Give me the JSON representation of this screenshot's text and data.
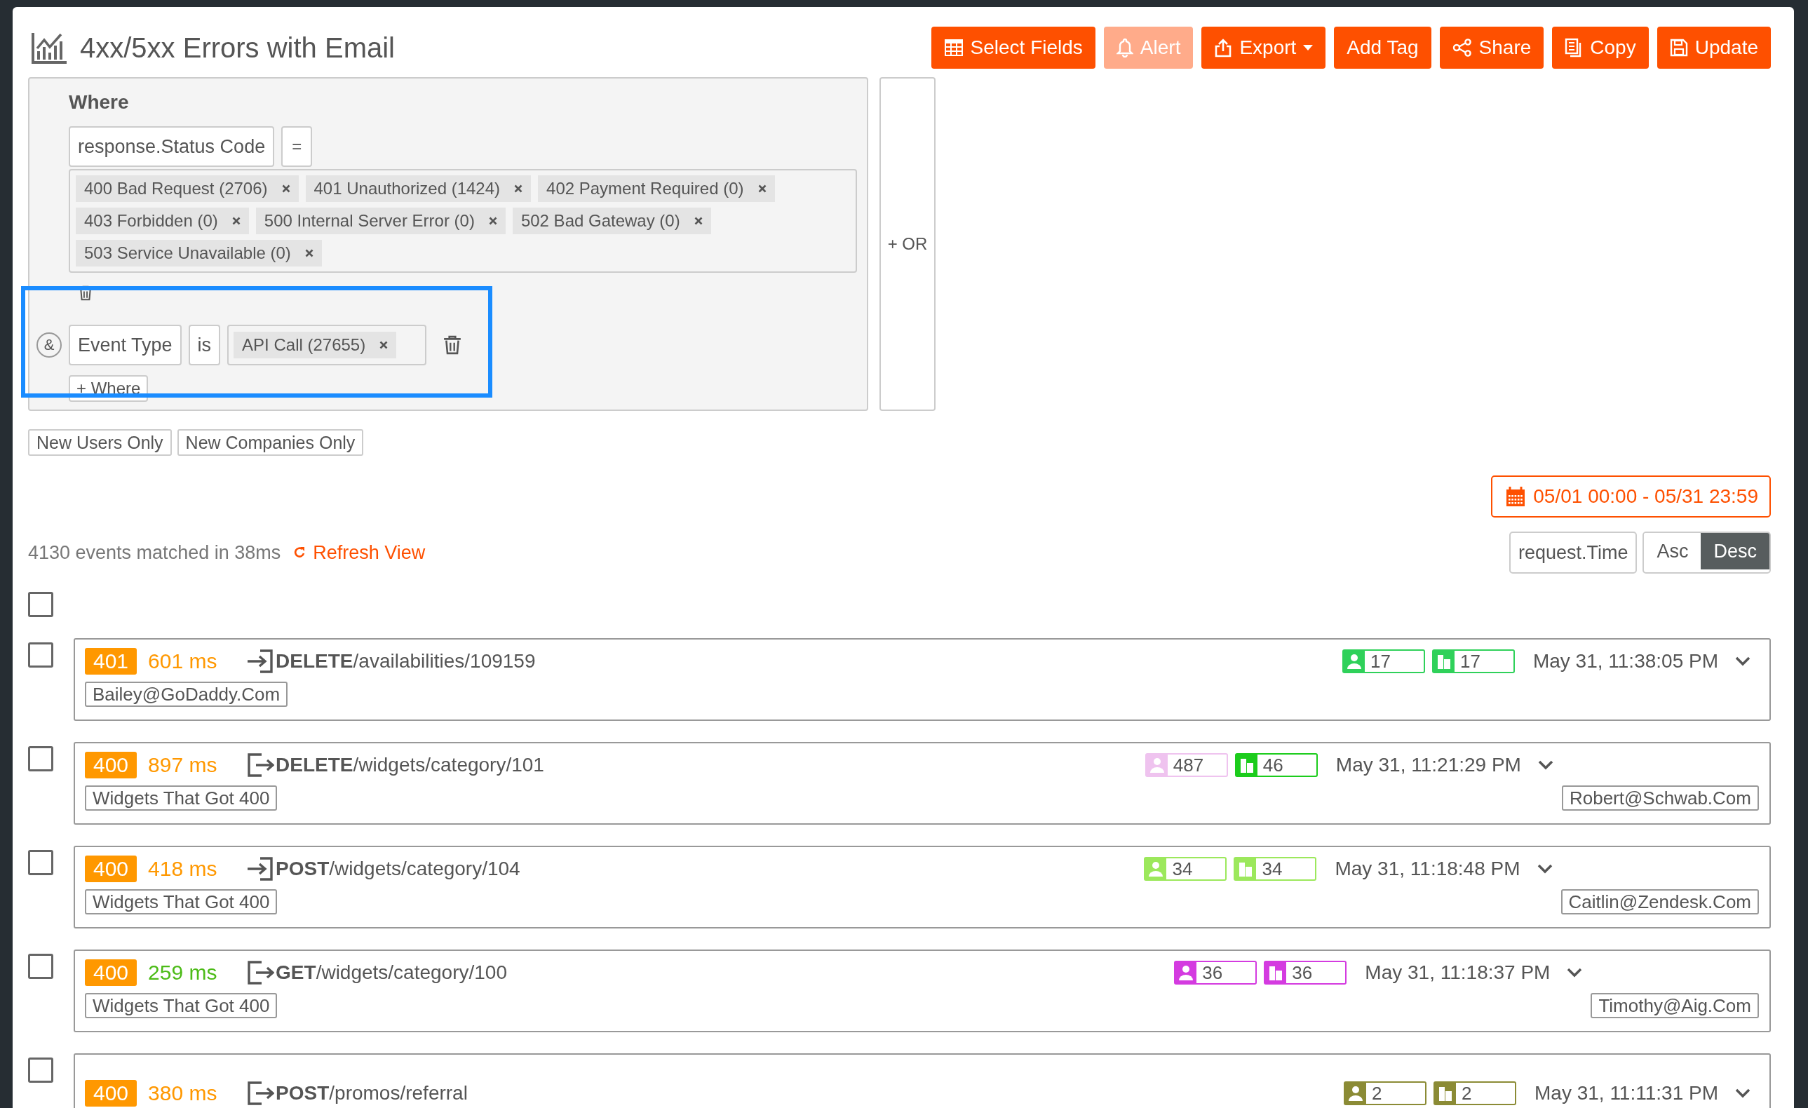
{
  "title": "4xx/5xx Errors with Email",
  "toolbar": [
    {
      "label": "Select Fields",
      "kind": "table",
      "disabled": false,
      "dropdown": false
    },
    {
      "label": "Alert",
      "kind": "bell",
      "disabled": true,
      "dropdown": false
    },
    {
      "label": "Export",
      "kind": "export",
      "disabled": false,
      "dropdown": true
    },
    {
      "label": "Add Tag",
      "kind": "plain",
      "disabled": false,
      "dropdown": false
    },
    {
      "label": "Share",
      "kind": "share",
      "disabled": false,
      "dropdown": false
    },
    {
      "label": "Copy",
      "kind": "copy",
      "disabled": false,
      "dropdown": false
    },
    {
      "label": "Update",
      "kind": "save",
      "disabled": false,
      "dropdown": false
    }
  ],
  "filter": {
    "label": "Where",
    "conditions": [
      {
        "kind": "block",
        "field": "response.Status Code",
        "operator": "=",
        "values": [
          "400 Bad Request (2706)",
          "401 Unauthorized (1424)",
          "402 Payment Required (0)",
          "403 Forbidden (0)",
          "500 Internal Server Error (0)",
          "502 Bad Gateway (0)",
          "503 Service Unavailable (0)"
        ]
      },
      {
        "kind": "inline",
        "connector": "&",
        "field": "Event Type",
        "operator": "is",
        "values": [
          "API Call (27655)"
        ]
      }
    ],
    "add_where": "+ Where",
    "add_or": "+ OR"
  },
  "quick_filters": [
    "New Users Only",
    "New Companies Only"
  ],
  "date_range": "05/01 00:00 - 05/31 23:59",
  "summary": "4130 events matched in 38ms",
  "refresh": "Refresh View",
  "sort": {
    "field": "request.Time",
    "orders": [
      {
        "label": "Asc",
        "selected": false
      },
      {
        "label": "Desc",
        "selected": true
      }
    ]
  },
  "select_all": {
    "checked": false
  },
  "events": [
    {
      "checked": false,
      "status": "401",
      "duration": {
        "text": "601 ms",
        "color": "#ff9800"
      },
      "kind": "in",
      "request": "**DELETE**/availabilities/109159",
      "users": {
        "count": "17",
        "color": "#2fd15a"
      },
      "companies": {
        "count": "17",
        "color": "#2fd15a"
      },
      "time": "May 31, 11:38:05 PM",
      "left_tag": "Bailey@GoDaddy.Com"
    },
    {
      "checked": false,
      "status": "400",
      "duration": {
        "text": "897 ms",
        "color": "#ff9800"
      },
      "kind": "out",
      "request": "**DELETE**/widgets/category/101",
      "users": {
        "count": "487",
        "color": "#efc3ef"
      },
      "companies": {
        "count": "46",
        "color": "#1ccc1c"
      },
      "time": "May 31, 11:21:29 PM",
      "left_tag": "Widgets That Got 400",
      "right_tag": "Robert@Schwab.Com"
    },
    {
      "checked": false,
      "status": "400",
      "duration": {
        "text": "418 ms",
        "color": "#ff9800"
      },
      "kind": "in",
      "request": "**POST**/widgets/category/104",
      "users": {
        "count": "34",
        "color": "#9ce85c"
      },
      "companies": {
        "count": "34",
        "color": "#9ce85c"
      },
      "time": "May 31, 11:18:48 PM",
      "left_tag": "Widgets That Got 400",
      "right_tag": "Caitlin@Zendesk.Com"
    },
    {
      "checked": false,
      "status": "400",
      "duration": {
        "text": "259 ms",
        "color": "#4cbb17"
      },
      "kind": "out",
      "request": "**GET**/widgets/category/100",
      "users": {
        "count": "36",
        "color": "#d43be0"
      },
      "companies": {
        "count": "36",
        "color": "#d43be0"
      },
      "time": "May 31, 11:18:37 PM",
      "left_tag": "Widgets That Got 400",
      "right_tag": "Timothy@Aig.Com"
    },
    {
      "checked": false,
      "status": "400",
      "duration": {
        "text": "380 ms",
        "color": "#ff9800"
      },
      "kind": "out",
      "request": "**POST**/promos/referral",
      "users": {
        "count": "2",
        "color": "#8b8b35"
      },
      "companies": {
        "count": "2",
        "color": "#8b8b35"
      },
      "time": "May 31, 11:11:31 PM"
    }
  ]
}
